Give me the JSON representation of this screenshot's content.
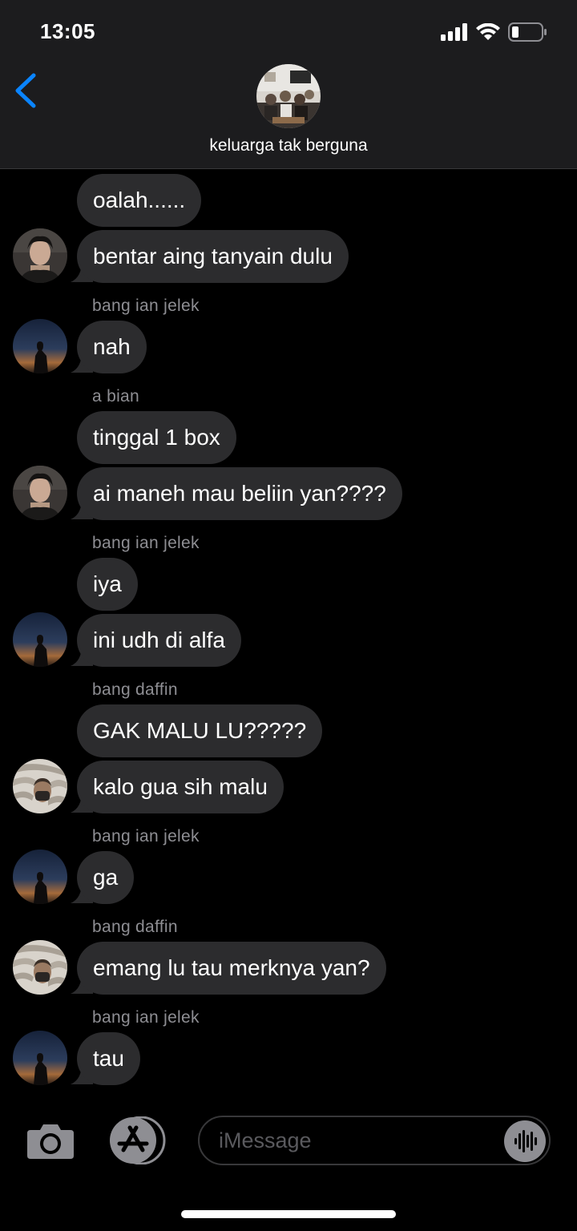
{
  "status_bar": {
    "time": "13:05"
  },
  "header": {
    "group_name": "keluarga tak berguna"
  },
  "colors": {
    "accent": "#0a84ff",
    "bubble": "#2c2c2e",
    "header_bg": "#1c1c1e",
    "sender_text": "#8e8e93"
  },
  "messages": [
    {
      "text": "oalah......"
    },
    {
      "text": "bentar aing tanyain dulu"
    },
    {
      "sender": "bang ian jelek",
      "text": "nah"
    },
    {
      "sender": "a bian",
      "text": "tinggal 1 box"
    },
    {
      "text": "ai maneh mau beliin yan????"
    },
    {
      "sender": "bang ian jelek",
      "text": "iya"
    },
    {
      "text": "ini udh di alfa"
    },
    {
      "sender": "bang daffin",
      "text": "GAK MALU LU?????"
    },
    {
      "text": "kalo gua sih malu"
    },
    {
      "sender": "bang ian jelek",
      "text": "ga"
    },
    {
      "sender": "bang daffin",
      "text": "emang lu tau merknya yan?"
    },
    {
      "sender": "bang ian jelek",
      "text": "tau"
    }
  ],
  "input": {
    "placeholder": "iMessage"
  },
  "icons": [
    "back-chevron-icon",
    "camera-icon",
    "app-store-icon",
    "audio-waveform-icon",
    "signal-icon",
    "wifi-icon",
    "battery-icon"
  ]
}
